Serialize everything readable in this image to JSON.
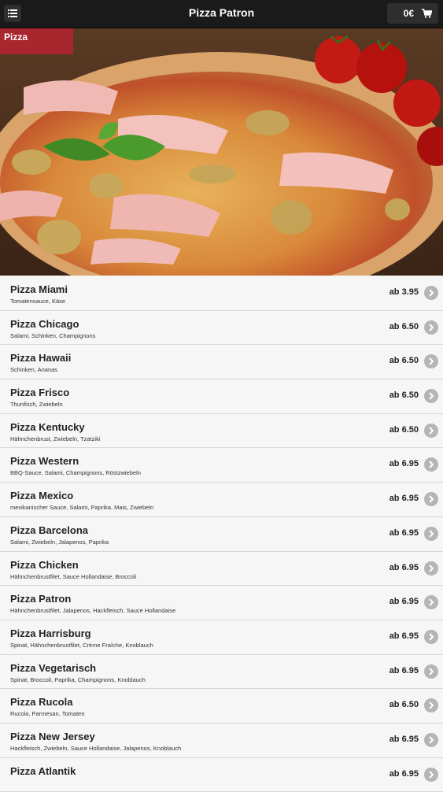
{
  "header": {
    "title": "Pizza Patron",
    "cart_total": "0€",
    "menu_icon": "menu-icon",
    "cart_icon": "cart-icon"
  },
  "category": {
    "label": "Pizza"
  },
  "colors": {
    "accent": "#a8262e",
    "header_bg": "#1a1a1a"
  },
  "items": [
    {
      "name": "Pizza Miami",
      "desc": "Tomatensauce, Käse",
      "price": "ab 3.95"
    },
    {
      "name": "Pizza Chicago",
      "desc": "Salami, Schinken, Champignons",
      "price": "ab 6.50"
    },
    {
      "name": "Pizza Hawaii",
      "desc": "Schinken, Ananas",
      "price": "ab 6.50"
    },
    {
      "name": "Pizza Frisco",
      "desc": "Thunfisch, Zwiebeln",
      "price": "ab 6.50"
    },
    {
      "name": "Pizza Kentucky",
      "desc": "Hähnchenbrust, Zwiebeln, Tzatziki",
      "price": "ab 6.50"
    },
    {
      "name": "Pizza Western",
      "desc": "BBQ-Sauce, Salami, Champignons, Röstzwiebeln",
      "price": "ab 6.95"
    },
    {
      "name": "Pizza Mexico",
      "desc": "mexikanischer Sauce, Salami, Paprika, Mais, Zwiebeln",
      "price": "ab 6.95"
    },
    {
      "name": "Pizza Barcelona",
      "desc": "Salami, Zwiebeln, Jalapenos, Paprika",
      "price": "ab 6.95"
    },
    {
      "name": "Pizza Chicken",
      "desc": "Hähnchenbrustfilet, Sauce Hollandaise, Broccoli",
      "price": "ab 6.95"
    },
    {
      "name": "Pizza Patron",
      "desc": "Hähnchenbrustfilet, Jalapenos, Hackfleisch, Sauce Hollandaise",
      "price": "ab 6.95"
    },
    {
      "name": "Pizza Harrisburg",
      "desc": "Spinat, Hähnchenbrustfilet, Crème Fraîche, Knoblauch",
      "price": "ab 6.95"
    },
    {
      "name": "Pizza Vegetarisch",
      "desc": "Spinat, Broccoli, Paprika, Champignons, Knoblauch",
      "price": "ab 6.95"
    },
    {
      "name": "Pizza Rucola",
      "desc": "Rucola, Parmesan, Tomaten",
      "price": "ab 6.50"
    },
    {
      "name": "Pizza New Jersey",
      "desc": "Hackfleisch, Zwiebeln, Sauce Hollandaise, Jalapenos, Knoblauch",
      "price": "ab 6.95"
    },
    {
      "name": "Pizza Atlantik",
      "desc": "",
      "price": "ab 6.95"
    }
  ]
}
